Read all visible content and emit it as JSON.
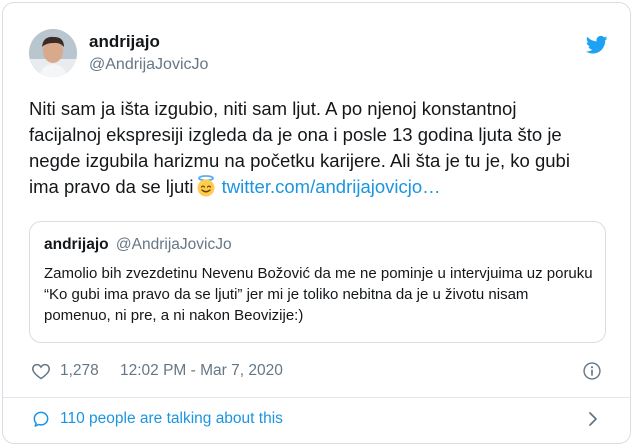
{
  "author": {
    "display_name": "andrijajo",
    "handle": "@AndrijaJovicJo"
  },
  "tweet": {
    "text_main": "Niti sam ja išta izgubio, niti sam ljut. A po njenoj konstantnoj facijalnoj ekspresiji izgleda da je ona i posle 13 godina ljuta što je negde izgubila harizmu na početku karijere. Ali šta je tu je, ko gubi ima pravo da se ljuti",
    "emoji": "smiling-face-with-halo",
    "link": "twitter.com/andrijajovicjo…"
  },
  "quoted_tweet": {
    "display_name": "andrijajo",
    "handle": "@AndrijaJovicJo",
    "text": "Zamolio bih zvezdetinu Nevenu Božović da me ne pominje u intervjuima uz poruku “Ko gubi ima pravo da se ljuti” jer mi je toliko nebitna da je u životu nisam pomenuo, ni pre, a ni nakon Beovizije:)"
  },
  "meta": {
    "likes": "1,278",
    "timestamp": "12:02 PM - Mar 7, 2020"
  },
  "footer": {
    "talking": "110 people are talking about this"
  },
  "colors": {
    "link": "#1b95e0",
    "secondary": "#657786",
    "border": "#d8dee3",
    "twitter_blue": "#1da1f2"
  }
}
